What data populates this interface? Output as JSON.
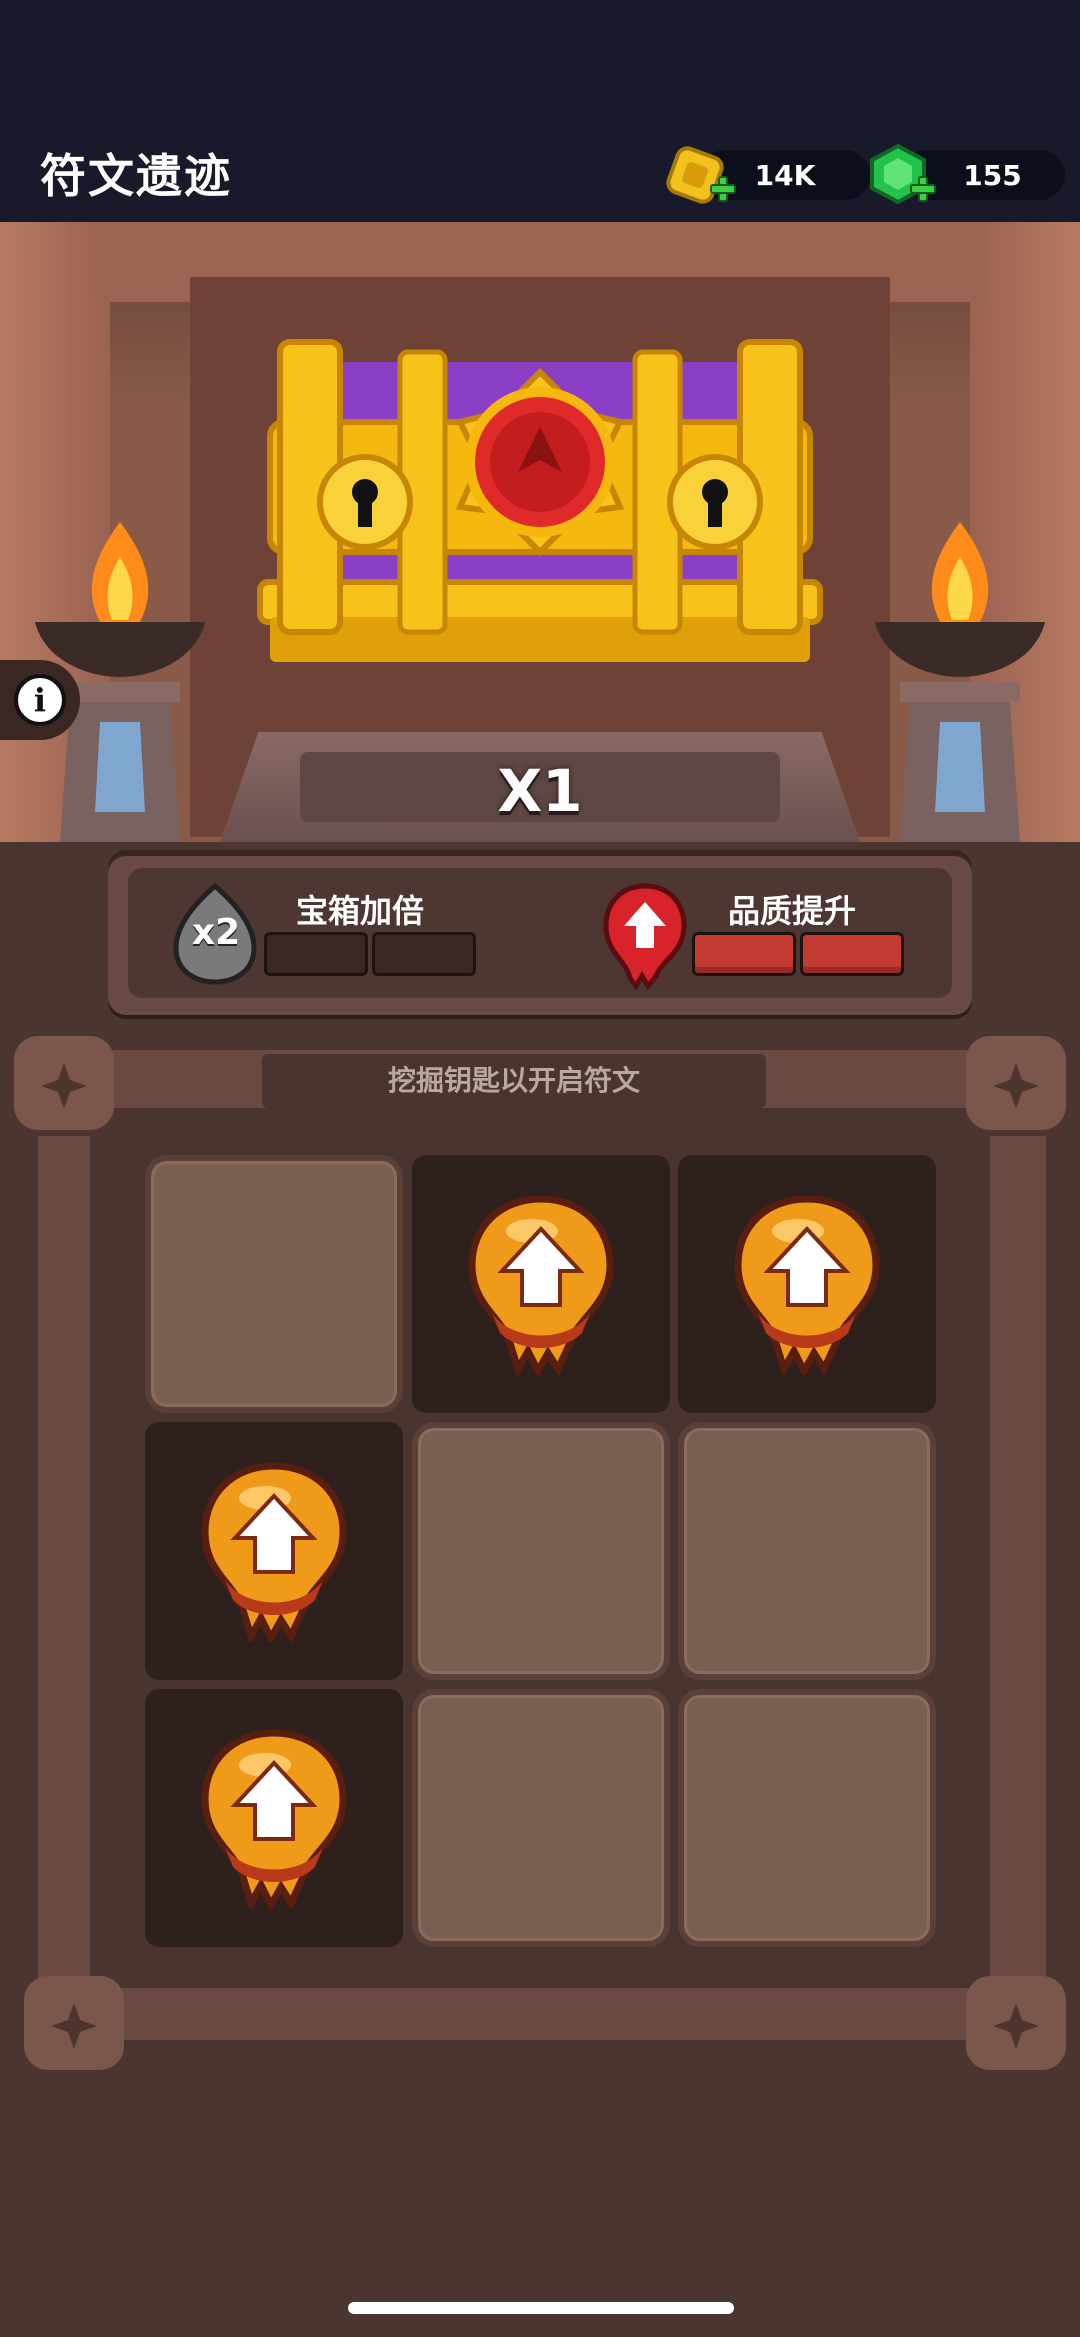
{
  "header": {
    "title": "符文遗迹",
    "coins": {
      "value": "14K",
      "icon": "gold-coin-icon"
    },
    "gems": {
      "value": "155",
      "icon": "green-gem-icon"
    }
  },
  "chest": {
    "multiplier": "X1",
    "icon": "treasure-chest-icon"
  },
  "info_button": {
    "icon": "info-icon",
    "label": "i"
  },
  "boosts": {
    "double": {
      "label": "宝箱加倍",
      "badge": "x2",
      "progress_filled": 0,
      "progress_total": 2
    },
    "quality": {
      "label": "品质提升",
      "progress_filled": 2,
      "progress_total": 2
    }
  },
  "board": {
    "header": "挖掘钥匙以开启符文",
    "cells": [
      {
        "state": "covered"
      },
      {
        "state": "revealed",
        "item": "quality-up-token"
      },
      {
        "state": "revealed",
        "item": "quality-up-token"
      },
      {
        "state": "revealed",
        "item": "quality-up-token"
      },
      {
        "state": "covered"
      },
      {
        "state": "covered"
      },
      {
        "state": "revealed",
        "item": "quality-up-token"
      },
      {
        "state": "covered"
      },
      {
        "state": "covered"
      }
    ]
  },
  "colors": {
    "topbar": "#181a2b",
    "gold": "#f2c11d",
    "gem": "#23c24a",
    "red_bar": "#c23a32",
    "token_orange": "#f09a1a"
  }
}
